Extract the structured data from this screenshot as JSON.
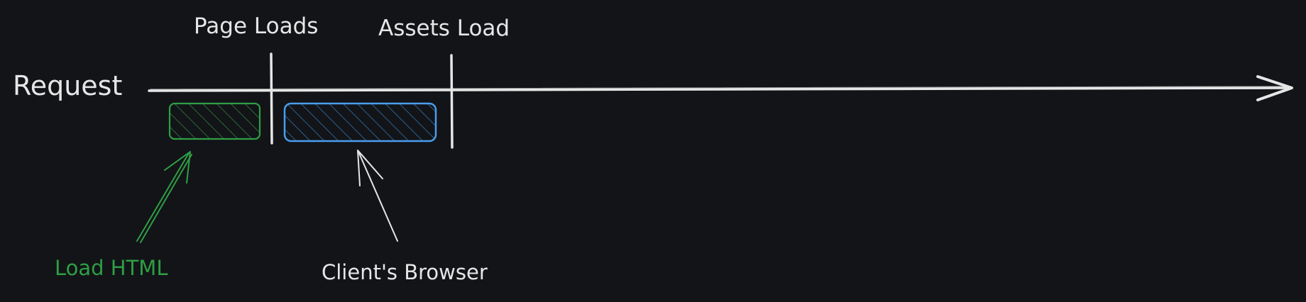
{
  "labels": {
    "request": "Request",
    "page_loads": "Page Loads",
    "assets_load": "Assets Load",
    "load_html": "Load HTML",
    "client_browser": "Client's Browser"
  },
  "colors": {
    "background": "#121418",
    "stroke": "#e6e6e6",
    "html_accent": "#2f9e44",
    "browser_accent": "#4a9eed"
  }
}
